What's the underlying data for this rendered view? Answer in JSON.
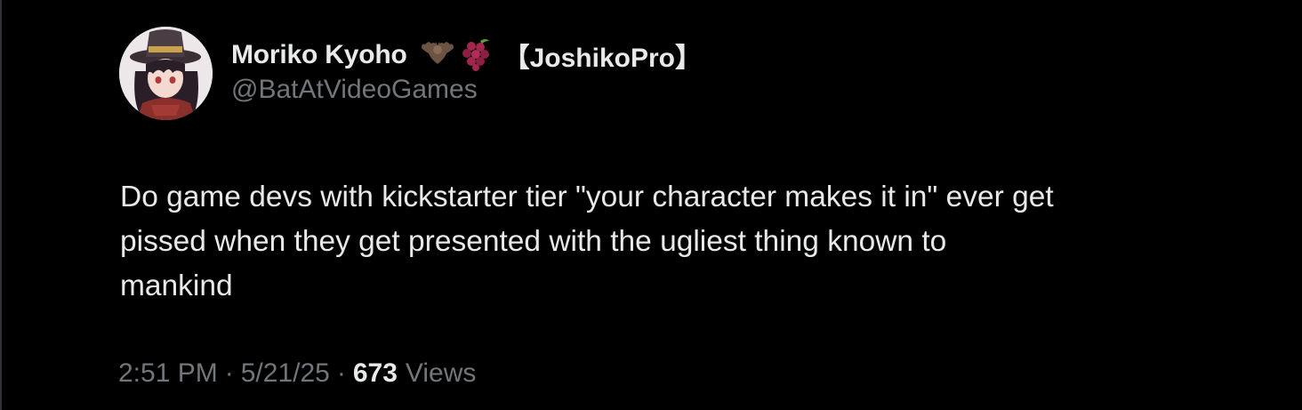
{
  "tweet": {
    "author": {
      "display_name": "Moriko Kyoho",
      "name_suffix": "【JoshikoPro】",
      "handle": "@BatAtVideoGames",
      "name_emoji_icons": [
        "bat-icon",
        "grapes-icon"
      ]
    },
    "text_lines": [
      "Do game devs with kickstarter tier \"your character makes it in\" ever get",
      "pissed when they get presented with the ugliest thing known to",
      "mankind"
    ],
    "meta": {
      "time": "2:51 PM",
      "separator": "·",
      "date": "5/21/25",
      "views_count": "673",
      "views_label": "Views"
    }
  },
  "colors": {
    "background": "#000000",
    "primary_text": "#e7e9ea",
    "secondary_text": "#71767b"
  }
}
